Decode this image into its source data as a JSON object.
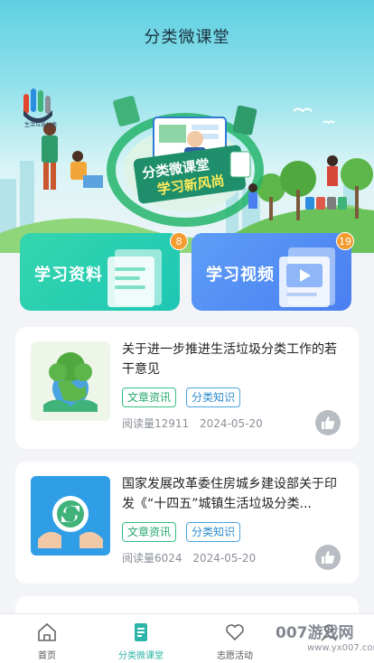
{
  "page": {
    "title": "分类微课堂"
  },
  "banner": {
    "headline_line1": "分类微课堂",
    "headline_line2": "学习新风尚",
    "logo_text": "生活垃圾分类"
  },
  "cards": [
    {
      "label": "学习资料",
      "count": "8"
    },
    {
      "label": "学习视频",
      "count": "19"
    }
  ],
  "articles": [
    {
      "title": "关于进一步推进生活垃圾分类工作的若干意见",
      "tags": [
        "文章资讯",
        "分类知识"
      ],
      "reads_label": "阅读量",
      "reads": "12911",
      "date": "2024-05-20"
    },
    {
      "title": "国家发展改革委住房城乡建设部关于印发《“十四五”城镇生活垃圾分类...",
      "tags": [
        "文章资讯",
        "分类知识"
      ],
      "reads_label": "阅读量",
      "reads": "6024",
      "date": "2024-05-20"
    }
  ],
  "tabbar": [
    {
      "label": "首页",
      "icon": "home-icon"
    },
    {
      "label": "分类微课堂",
      "icon": "book-icon",
      "active": true
    },
    {
      "label": "志愿活动",
      "icon": "heart-icon"
    },
    {
      "label": "",
      "icon": "user-icon"
    }
  ],
  "watermark": {
    "text": "007游戏网",
    "sub": "www.yx007.com"
  },
  "colors": {
    "accent": "#2db4a8",
    "badge": "#f59b2f",
    "study_card": "#1ec7b4",
    "video_card": "#4a7ff0"
  }
}
